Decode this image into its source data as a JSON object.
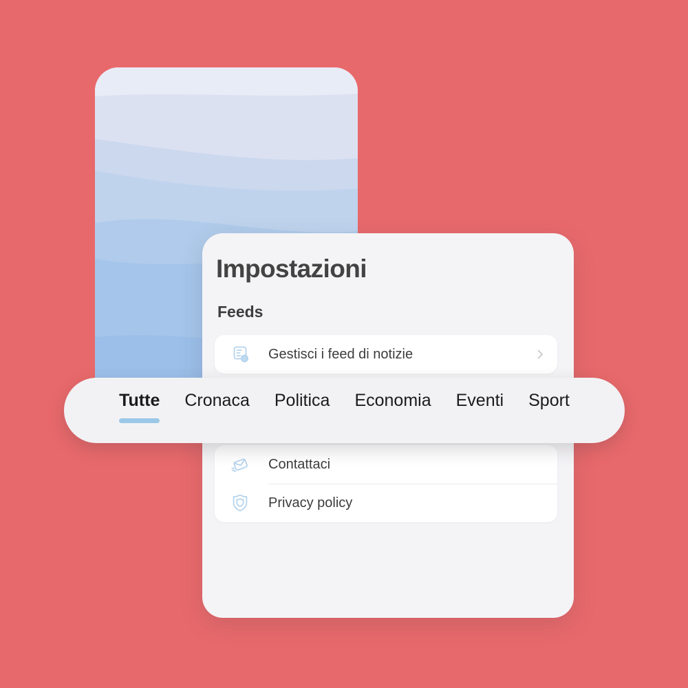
{
  "theme": {
    "background_color": "#E8696B",
    "card_color": "#F4F4F6",
    "row_color": "#FFFFFF",
    "accent_color": "#9CC8E8",
    "icon_color": "#B5D4EE",
    "text_color": "#3C3C3C"
  },
  "phone_mockup": {
    "name": "phone-wallpaper",
    "wave_colors": [
      "#E8ECF7",
      "#DADFF0",
      "#CBD8EE",
      "#BAD1EC",
      "#ACC8EA",
      "#9CBFE9",
      "#93B6E8"
    ]
  },
  "settings_card": {
    "title": "Impostazioni",
    "sections": [
      {
        "label": "Feeds",
        "rows": [
          {
            "label": "Gestisci i feed di notizie",
            "icon": "feed-settings-icon",
            "chevron": "chevron-right-icon"
          }
        ]
      },
      {
        "label": "",
        "rows": [
          {
            "label": "Contattaci",
            "icon": "envelope-send-icon"
          },
          {
            "label": "Privacy policy",
            "icon": "shield-icon"
          }
        ]
      }
    ]
  },
  "tab_bar": {
    "tabs": [
      {
        "label": "Tutte",
        "active": true
      },
      {
        "label": "Cronaca",
        "active": false
      },
      {
        "label": "Politica",
        "active": false
      },
      {
        "label": "Economia",
        "active": false
      },
      {
        "label": "Eventi",
        "active": false
      },
      {
        "label": "Sport",
        "active": false
      }
    ]
  }
}
